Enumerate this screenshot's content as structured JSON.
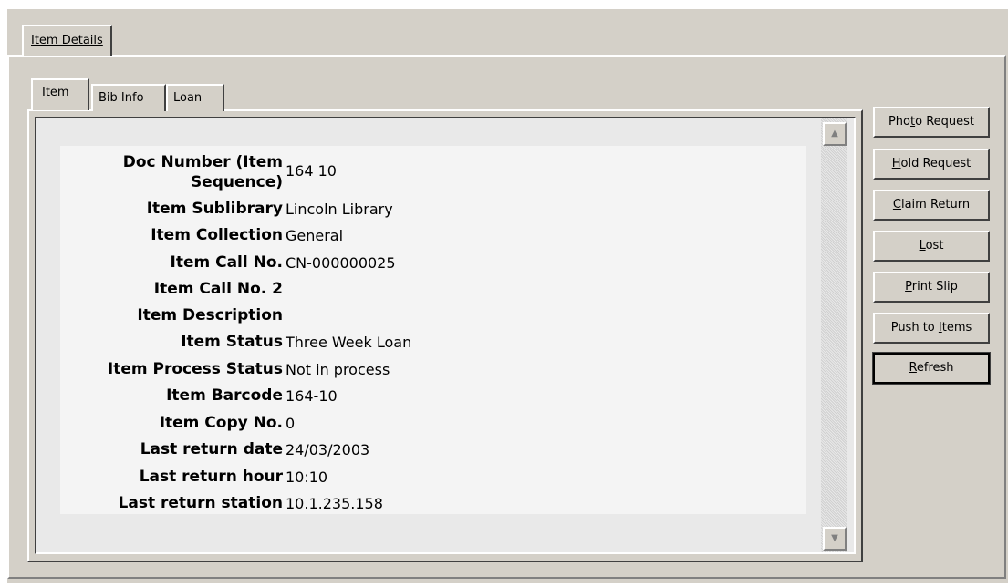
{
  "outer_tab": {
    "label": "Item Details"
  },
  "inner_tabs": [
    {
      "label": "Item",
      "active": true
    },
    {
      "label": "Bib Info",
      "active": false
    },
    {
      "label": "Loan",
      "active": false
    }
  ],
  "fields": [
    {
      "label_l1": "Doc Number (Item",
      "label_l2": "Sequence)",
      "value": "164 10"
    },
    {
      "label": "Item Sublibrary",
      "value": "Lincoln Library"
    },
    {
      "label": "Item Collection",
      "value": "General"
    },
    {
      "label": "Item Call No.",
      "value": "CN-000000025"
    },
    {
      "label": "Item Call No. 2",
      "value": ""
    },
    {
      "label": "Item Description",
      "value": ""
    },
    {
      "label": "Item Status",
      "value": "Three Week Loan"
    },
    {
      "label": "Item Process Status",
      "value": "Not in process"
    },
    {
      "label": "Item Barcode",
      "value": "164-10"
    },
    {
      "label": "Item Copy No.",
      "value": "0"
    },
    {
      "label": "Last return date",
      "value": "24/03/2003"
    },
    {
      "label": "Last return hour",
      "value": "10:10"
    },
    {
      "label": "Last return station",
      "value": "10.1.235.158"
    }
  ],
  "buttons": [
    {
      "label": "Photo Request",
      "accel": "t"
    },
    {
      "label": "Hold Request",
      "accel": "H"
    },
    {
      "label": "Claim Return",
      "accel": "C"
    },
    {
      "label": "Lost",
      "accel": "L"
    },
    {
      "label": "Print Slip",
      "accel": "P"
    },
    {
      "label": "Push to Items",
      "accel": "I"
    },
    {
      "label": "Refresh",
      "accel": "R"
    }
  ],
  "scrollbar": {
    "up_icon": "triangle-up",
    "down_icon": "triangle-down"
  }
}
